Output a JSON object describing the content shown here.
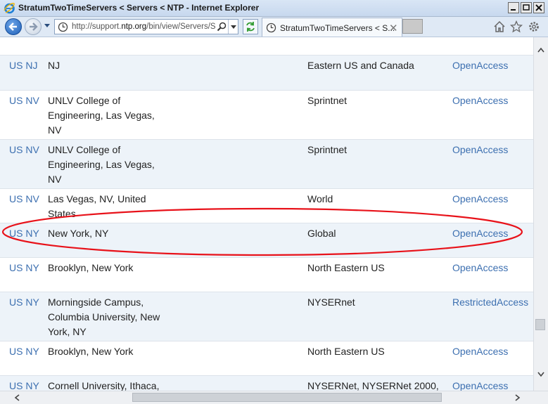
{
  "window": {
    "title": "StratumTwoTimeServers < Servers < NTP - Internet Explorer"
  },
  "toolbar": {
    "url_prefix": "http://support.",
    "url_domain": "ntp.org",
    "url_suffix": "/bin/view/Servers/S",
    "tab_title": "StratumTwoTimeServers < S...",
    "tab_close": "✕"
  },
  "table": {
    "rows": [
      {
        "code": "US NJ",
        "location": "NJ",
        "network": "Eastern US and Canada",
        "access": "OpenAccess"
      },
      {
        "code": "US NV",
        "location": "UNLV College of Engineering, Las Vegas, NV",
        "network": "Sprintnet",
        "access": "OpenAccess"
      },
      {
        "code": "US NV",
        "location": "UNLV College of Engineering, Las Vegas, NV",
        "network": "Sprintnet",
        "access": "OpenAccess"
      },
      {
        "code": "US NV",
        "location": "Las Vegas, NV, United States",
        "network": "World",
        "access": "OpenAccess"
      },
      {
        "code": "US NY",
        "location": "New York, NY",
        "network": "Global",
        "access": "OpenAccess"
      },
      {
        "code": "US NY",
        "location": "Brooklyn, New York",
        "network": "North Eastern US",
        "access": "OpenAccess"
      },
      {
        "code": "US NY",
        "location": "Morningside Campus, Columbia University, New York, NY",
        "network": "NYSERnet",
        "access": "RestrictedAccess"
      },
      {
        "code": "US NY",
        "location": "Brooklyn, New York",
        "network": "North Eastern US",
        "access": "OpenAccess"
      },
      {
        "code": "US NY",
        "location": "Cornell University, Ithaca,",
        "network": "NYSERNet, NYSERNet 2000,",
        "access": "OpenAccess"
      }
    ]
  },
  "annotation": {
    "highlighted_row": 4,
    "color": "#e8121a"
  },
  "colors": {
    "link": "#3c6fb0",
    "row_shade": "#edf3f9"
  }
}
